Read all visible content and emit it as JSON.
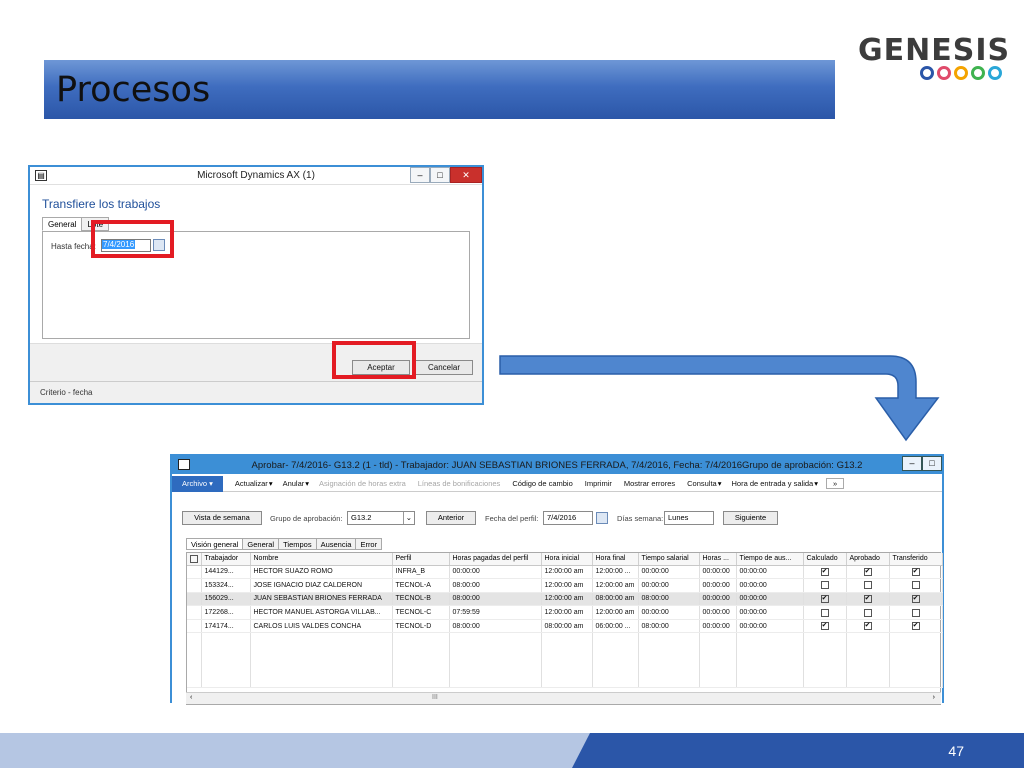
{
  "slide": {
    "title": "Procesos",
    "page_number": "47"
  },
  "logo": {
    "text": "GENESIS",
    "ring_colors": [
      "#2b56a8",
      "#e04b6b",
      "#f4a300",
      "#3fb34f",
      "#2aa7d8"
    ]
  },
  "dialog1": {
    "window_title": "Microsoft Dynamics AX (1)",
    "heading": "Transfiere los trabajos",
    "tabs": [
      "General",
      "Lote"
    ],
    "field_label": "Hasta fecha:",
    "date_value": "7/4/2016",
    "accept_label": "Aceptar",
    "cancel_label": "Cancelar",
    "status": "Criterio - fecha"
  },
  "window2": {
    "title": "Aprobar- 7/4/2016- G13.2 (1 - tld) - Trabajador: JUAN SEBASTIAN BRIONES FERRADA, 7/4/2016, Fecha: 7/4/2016Grupo de aprobación: G13.2",
    "menu": {
      "archivo": "Archivo",
      "items": [
        "Actualizar",
        "Anular",
        "Asignación de horas extra",
        "Líneas de bonificaciones",
        "Código de cambio",
        "Imprimir",
        "Mostrar errores",
        "Consulta",
        "Hora de entrada y salida"
      ],
      "disabled": [
        false,
        false,
        true,
        true,
        false,
        false,
        false,
        false,
        false
      ],
      "dropdown": [
        true,
        true,
        false,
        false,
        false,
        false,
        false,
        true,
        true
      ]
    },
    "toolbar": {
      "vista_semana": "Vista de semana",
      "grupo_label": "Grupo de aprobación:",
      "grupo_value": "G13.2",
      "anterior": "Anterior",
      "fecha_label": "Fecha del perfil:",
      "fecha_value": "7/4/2016",
      "dias_label": "Días semana:",
      "dias_value": "Lunes",
      "siguiente": "Siguiente"
    },
    "tabs": [
      "Visión general",
      "General",
      "Tiempos",
      "Ausencia",
      "Error"
    ],
    "columns": [
      "",
      "Trabajador",
      "Nombre",
      "Perfil",
      "Horas pagadas del perfil",
      "Hora inicial",
      "Hora final",
      "Tiempo salarial",
      "Horas ...",
      "Tiempo de aus...",
      "Calculado",
      "Aprobado",
      "Transferido"
    ],
    "rows": [
      {
        "trabajador": "144129...",
        "nombre": "HECTOR SUAZO  ROMO",
        "perfil": "INFRA_B",
        "horas": "00:00:00",
        "inicial": "12:00:00 am",
        "final": "12:00:00 ...",
        "salarial": "00:00:00",
        "horas2": "00:00:00",
        "aus": "00:00:00",
        "calculado": true,
        "aprobado": true,
        "transferido": true,
        "selected": false
      },
      {
        "trabajador": "153324...",
        "nombre": "JOSE IGNACIO DIAZ CALDERON",
        "perfil": "TECNOL-A",
        "horas": "08:00:00",
        "inicial": "12:00:00 am",
        "final": "12:00:00 am",
        "salarial": "00:00:00",
        "horas2": "00:00:00",
        "aus": "00:00:00",
        "calculado": false,
        "aprobado": false,
        "transferido": false,
        "selected": false
      },
      {
        "trabajador": "156029...",
        "nombre": "JUAN SEBASTIAN BRIONES FERRADA",
        "perfil": "TECNOL-B",
        "horas": "08:00:00",
        "inicial": "12:00:00 am",
        "final": "08:00:00 am",
        "salarial": "08:00:00",
        "horas2": "00:00:00",
        "aus": "00:00:00",
        "calculado": true,
        "aprobado": true,
        "transferido": true,
        "selected": true
      },
      {
        "trabajador": "172268...",
        "nombre": "HECTOR MANUEL ASTORGA  VILLAB...",
        "perfil": "TECNOL-C",
        "horas": "07:59:59",
        "inicial": "12:00:00 am",
        "final": "12:00:00 am",
        "salarial": "00:00:00",
        "horas2": "00:00:00",
        "aus": "00:00:00",
        "calculado": false,
        "aprobado": false,
        "transferido": false,
        "selected": false
      },
      {
        "trabajador": "174174...",
        "nombre": "CARLOS LUIS VALDES  CONCHA",
        "perfil": "TECNOL-D",
        "horas": "08:00:00",
        "inicial": "08:00:00 am",
        "final": "06:00:00 ...",
        "salarial": "08:00:00",
        "horas2": "00:00:00",
        "aus": "00:00:00",
        "calculado": true,
        "aprobado": true,
        "transferido": true,
        "selected": false
      }
    ],
    "scroll_glyph": "III"
  },
  "colors": {
    "highlight": "#e31b23",
    "accent": "#2b56a8",
    "window_border": "#3c8fd6"
  }
}
